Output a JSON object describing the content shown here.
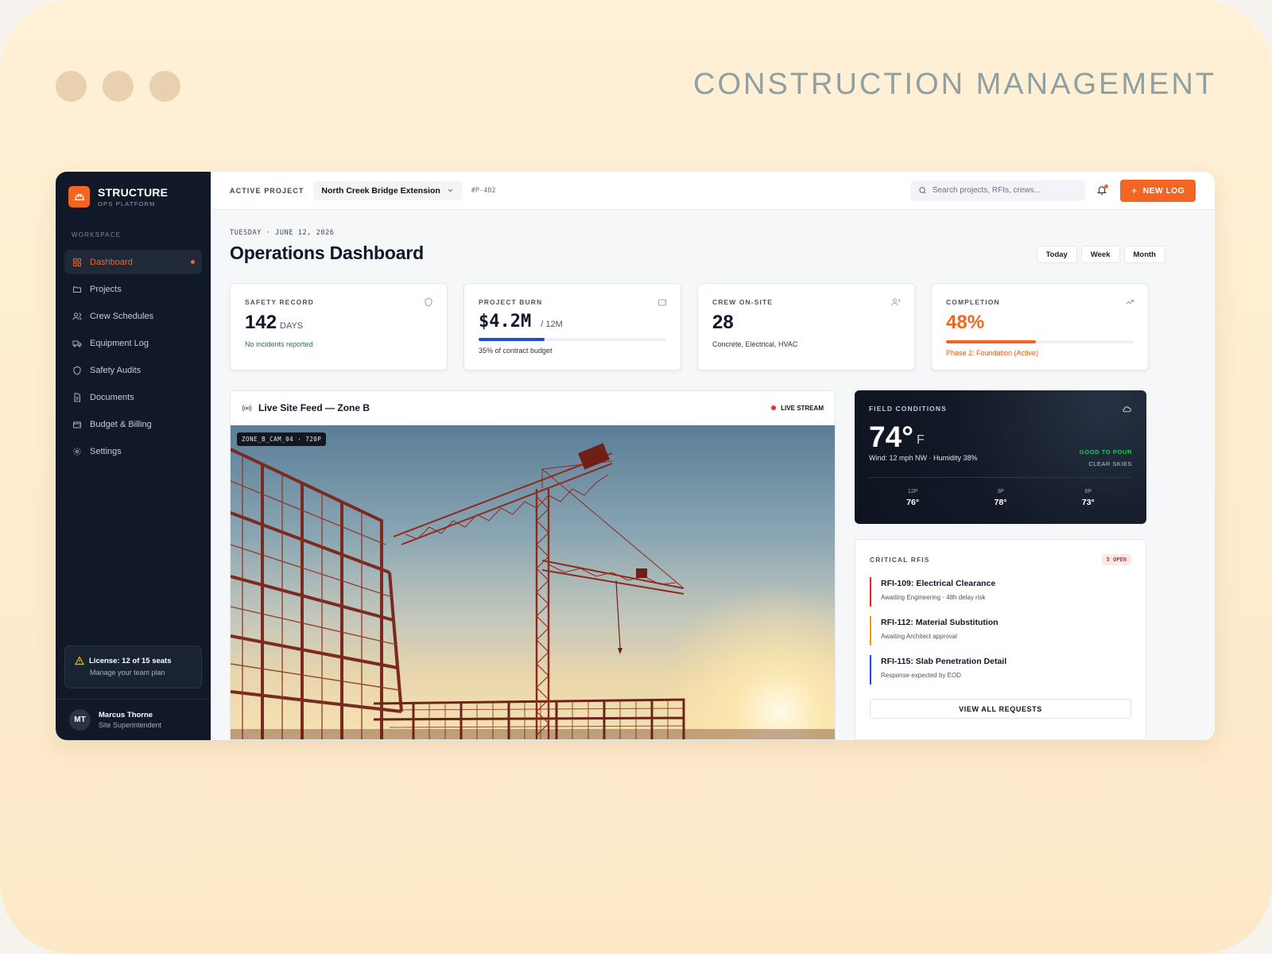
{
  "page": {
    "heading": "CONSTRUCTION MANAGEMENT"
  },
  "colors": {
    "accent": "#f26522",
    "sidebar_bg": "#111827",
    "success": "#15803d",
    "danger": "#dc2626",
    "info": "#1d4ed8",
    "warning": "#f59e0b"
  },
  "brand": {
    "name": "STRUCTURE",
    "subtitle": "OPS PLATFORM",
    "icon": "hard-hat-icon"
  },
  "sidebar": {
    "section_label": "WORKSPACE",
    "items": [
      {
        "label": "Dashboard",
        "icon": "grid-icon",
        "active": true
      },
      {
        "label": "Projects",
        "icon": "folder-icon"
      },
      {
        "label": "Crew Schedules",
        "icon": "users-icon"
      },
      {
        "label": "Equipment Log",
        "icon": "truck-icon"
      },
      {
        "label": "Safety Audits",
        "icon": "shield-icon"
      },
      {
        "label": "Documents",
        "icon": "document-icon"
      },
      {
        "label": "Budget & Billing",
        "icon": "wallet-icon"
      },
      {
        "label": "Settings",
        "icon": "gear-icon"
      }
    ],
    "license": {
      "title": "License: 12 of 15 seats",
      "subtitle": "Manage your team plan",
      "icon": "warning-icon"
    },
    "user": {
      "initials": "MT",
      "name": "Marcus Thorne",
      "role": "Site Superintendent"
    }
  },
  "topbar": {
    "label": "ACTIVE PROJECT",
    "project": "North Creek Bridge Extension",
    "project_id": "#P-402",
    "search_placeholder": "Search projects, RFIs, crews...",
    "new_log_label": "NEW LOG"
  },
  "header": {
    "date": "TUESDAY · JUNE 12, 2026",
    "title": "Operations Dashboard",
    "ranges": [
      "Today",
      "Week",
      "Month"
    ]
  },
  "kpis": {
    "safety": {
      "label": "SAFETY RECORD",
      "value": "142",
      "unit": "DAYS",
      "sub": "No incidents reported",
      "icon": "shield-icon"
    },
    "burn": {
      "label": "PROJECT BURN",
      "value": "$4.2M",
      "unit": "/ 12M",
      "sub": "35% of contract budget",
      "progress": 0.35,
      "icon": "wallet-icon"
    },
    "crew": {
      "label": "CREW ON-SITE",
      "value": "28",
      "sub": "Concrete, Electrical, HVAC",
      "icon": "users-icon"
    },
    "completion": {
      "label": "COMPLETION",
      "value": "48%",
      "sub": "Phase 2: Foundation (Active)",
      "progress": 0.48,
      "icon": "trending-up-icon"
    }
  },
  "feed": {
    "title": "Live Site Feed — Zone B",
    "live_label": "LIVE STREAM",
    "camera_tag": "ZONE_B_CAM_04 · 720P"
  },
  "weather": {
    "label": "FIELD CONDITIONS",
    "temp": "74°",
    "unit": "F",
    "sub": "Wind: 12 mph NW · Humidity 38%",
    "status": "GOOD TO POUR",
    "sky": "CLEAR SKIES",
    "forecast": [
      {
        "time": "12P",
        "temp": "76°"
      },
      {
        "time": "3P",
        "temp": "78°"
      },
      {
        "time": "6P",
        "temp": "73°"
      }
    ]
  },
  "rfis": {
    "label": "CRITICAL RFIS",
    "badge": "5 OPEN",
    "items": [
      {
        "title": "RFI-109: Electrical Clearance",
        "sub": "Awaiting Engineering · 48h delay risk",
        "color": "#dc2626"
      },
      {
        "title": "RFI-112: Material Substitution",
        "sub": "Awaiting Architect approval",
        "color": "#f59e0b"
      },
      {
        "title": "RFI-115: Slab Penetration Detail",
        "sub": "Response expected by EOD",
        "color": "#1d4ed8"
      }
    ],
    "view_all_label": "VIEW ALL REQUESTS"
  }
}
